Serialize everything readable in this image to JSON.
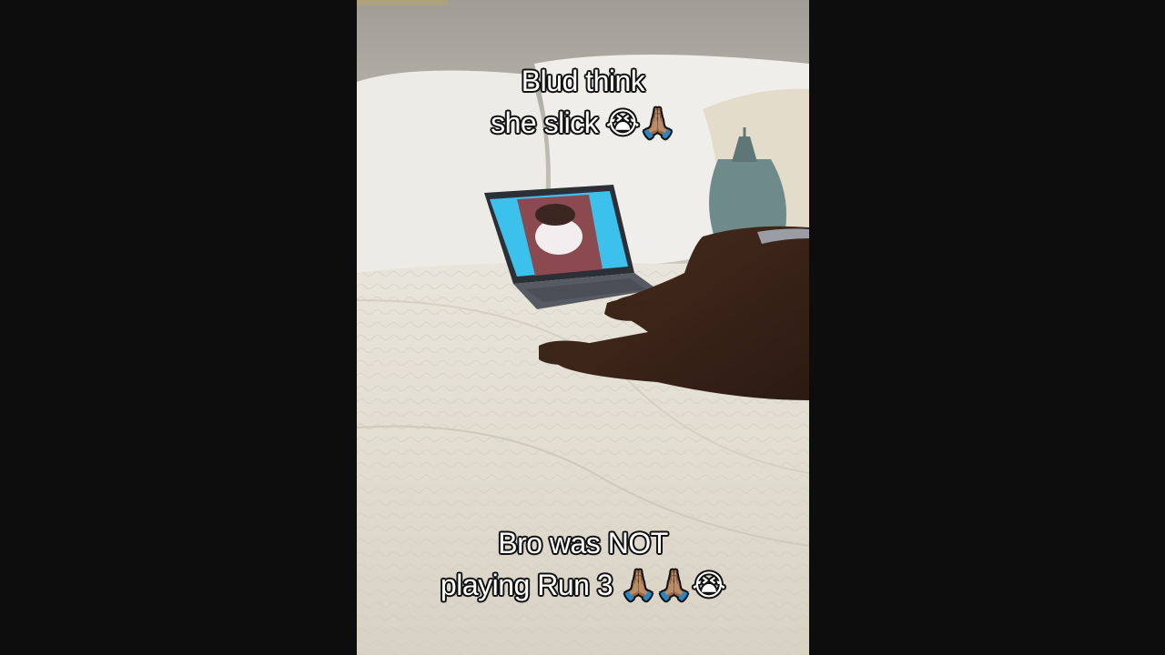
{
  "captions": {
    "top": [
      "Blud think",
      "she slick 😭🙏🏽"
    ],
    "bottom": [
      "Bro was NOT",
      "playing Run 3 🙏🏽🙏🏽😭"
    ]
  },
  "scene": {
    "description_icons": [
      "laptop-icon",
      "dog-icon",
      "bed-icon",
      "pillow-icon",
      "tassel-icon"
    ],
    "colors": {
      "letterbox": "#0d0d0d",
      "bedspread": "#e6e1d6",
      "laptop_screen": "#3cc0ec",
      "dog": "#3a2418"
    }
  }
}
